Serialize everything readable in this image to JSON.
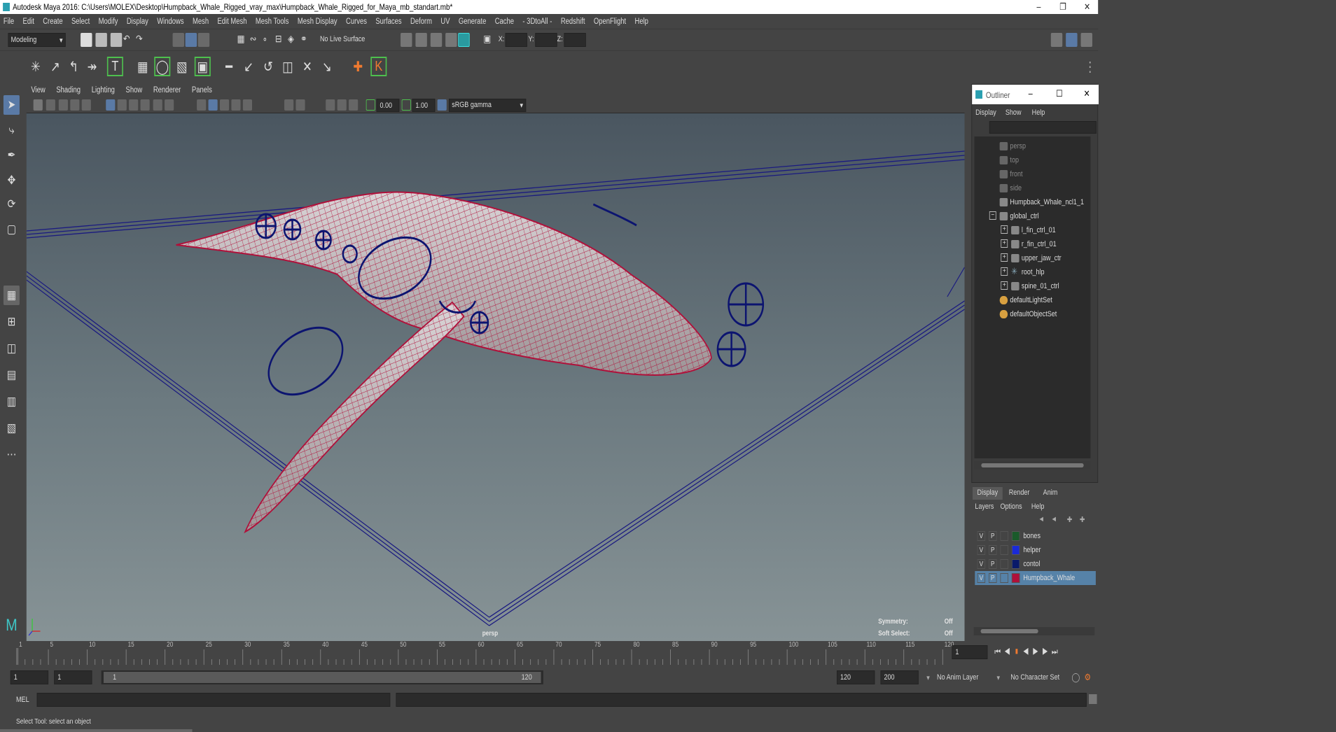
{
  "window": {
    "title": "Autodesk Maya 2016: C:\\Users\\MOLEX\\Desktop\\Humpback_Whale_Rigged_vray_max\\Humpback_Whale_Rigged_for_Maya_mb_standart.mb*"
  },
  "menubar": [
    "File",
    "Edit",
    "Create",
    "Select",
    "Modify",
    "Display",
    "Windows",
    "Mesh",
    "Edit Mesh",
    "Mesh Tools",
    "Mesh Display",
    "Curves",
    "Surfaces",
    "Deform",
    "UV",
    "Generate",
    "Cache",
    "- 3DtoAll -",
    "Redshift",
    "OpenFlight",
    "Help"
  ],
  "status": {
    "mode": "Modeling",
    "live": "No Live Surface",
    "x": "X:",
    "y": "Y:",
    "z": "Z:"
  },
  "panel": {
    "menu": [
      "View",
      "Shading",
      "Lighting",
      "Show",
      "Renderer",
      "Panels"
    ],
    "exposure": "0.00",
    "gamma": "1.00",
    "colorspace": "sRGB gamma",
    "camera": "persp",
    "symmetry_label": "Symmetry:",
    "symmetry_val": "Off",
    "soft_label": "Soft Select:",
    "soft_val": "Off"
  },
  "outliner": {
    "title": "Outliner",
    "menu": [
      "Display",
      "Show",
      "Help"
    ],
    "items": [
      {
        "label": "persp",
        "dim": true
      },
      {
        "label": "top",
        "dim": true
      },
      {
        "label": "front",
        "dim": true
      },
      {
        "label": "side",
        "dim": true
      },
      {
        "label": "Humpback_Whale_ncl1_1",
        "dim": false
      },
      {
        "label": "global_ctrl",
        "dim": false
      },
      {
        "label": "l_fin_ctrl_01",
        "dim": false
      },
      {
        "label": "r_fin_ctrl_01",
        "dim": false
      },
      {
        "label": "upper_jaw_ctr",
        "dim": false
      },
      {
        "label": "root_hlp",
        "dim": false
      },
      {
        "label": "spine_01_ctrl",
        "dim": false
      },
      {
        "label": "defaultLightSet",
        "dim": false
      },
      {
        "label": "defaultObjectSet",
        "dim": false
      }
    ]
  },
  "layers": {
    "tabs": [
      "Display",
      "Render",
      "Anim"
    ],
    "menu": [
      "Layers",
      "Options",
      "Help"
    ],
    "rows": [
      {
        "v": "V",
        "p": "P",
        "color": "#1a5a2a",
        "name": "bones"
      },
      {
        "v": "V",
        "p": "P",
        "color": "#1a2ad8",
        "name": "helper"
      },
      {
        "v": "V",
        "p": "P",
        "color": "#0a1a6a",
        "name": "contol"
      },
      {
        "v": "V",
        "p": "P",
        "color": "#b0103a",
        "name": "Humpback_Whale"
      }
    ]
  },
  "timeline": {
    "ticks": [
      "1",
      "5",
      "10",
      "15",
      "20",
      "25",
      "30",
      "35",
      "40",
      "45",
      "50",
      "55",
      "60",
      "65",
      "70",
      "75",
      "80",
      "85",
      "90",
      "95",
      "100",
      "105",
      "110",
      "115",
      "120"
    ],
    "current": "1"
  },
  "range": {
    "start": "1",
    "inner_start": "1",
    "slider_start": "1",
    "slider_end": "120",
    "end": "120",
    "max": "200",
    "anim_layer": "No Anim Layer",
    "char_set": "No Character Set"
  },
  "mel": {
    "label": "MEL"
  },
  "help": {
    "text": "Select Tool: select an object"
  }
}
